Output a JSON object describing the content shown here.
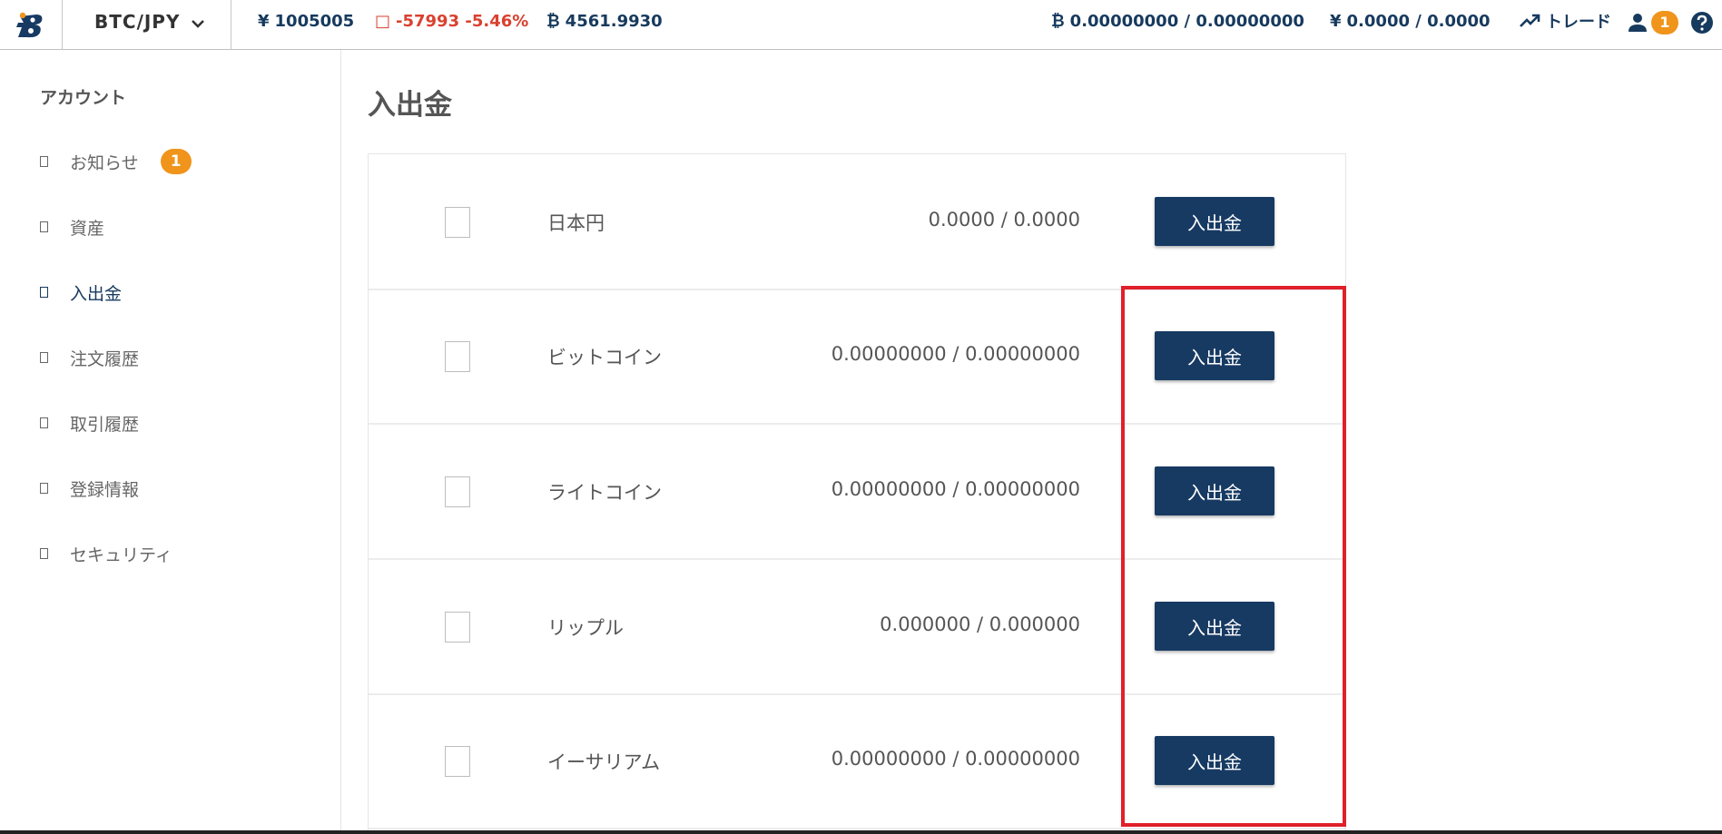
{
  "header": {
    "pair": "BTC/JPY",
    "price_symbol": "¥",
    "price": "1005005",
    "change_icon": "□",
    "change": "-57993 -5.46%",
    "volume_symbol": "₿",
    "volume": "4561.9930",
    "btc_balance_symbol": "₿",
    "btc_balance": "0.00000000 / 0.00000000",
    "jpy_balance_symbol": "¥",
    "jpy_balance": "0.0000 / 0.0000",
    "trade_label": "トレード",
    "notification_count": "1",
    "colors": {
      "accent": "#173a63",
      "badge": "#f0941c",
      "negative": "#d9412f",
      "highlight": "#e0202a"
    }
  },
  "sidebar": {
    "title": "アカウント",
    "items": [
      {
        "label": "お知らせ",
        "badge": "1"
      },
      {
        "label": "資産"
      },
      {
        "label": "入出金",
        "active": true
      },
      {
        "label": "注文履歴"
      },
      {
        "label": "取引履歴"
      },
      {
        "label": "登録情報"
      },
      {
        "label": "セキュリティ"
      }
    ]
  },
  "main": {
    "title": "入出金",
    "rows": [
      {
        "name": "日本円",
        "balance": "0.0000 / 0.0000",
        "button": "入出金"
      },
      {
        "name": "ビットコイン",
        "balance": "0.00000000 / 0.00000000",
        "button": "入出金"
      },
      {
        "name": "ライトコイン",
        "balance": "0.00000000 / 0.00000000",
        "button": "入出金"
      },
      {
        "name": "リップル",
        "balance": "0.000000 / 0.000000",
        "button": "入出金"
      },
      {
        "name": "イーサリアム",
        "balance": "0.00000000 / 0.00000000",
        "button": "入出金"
      }
    ]
  }
}
